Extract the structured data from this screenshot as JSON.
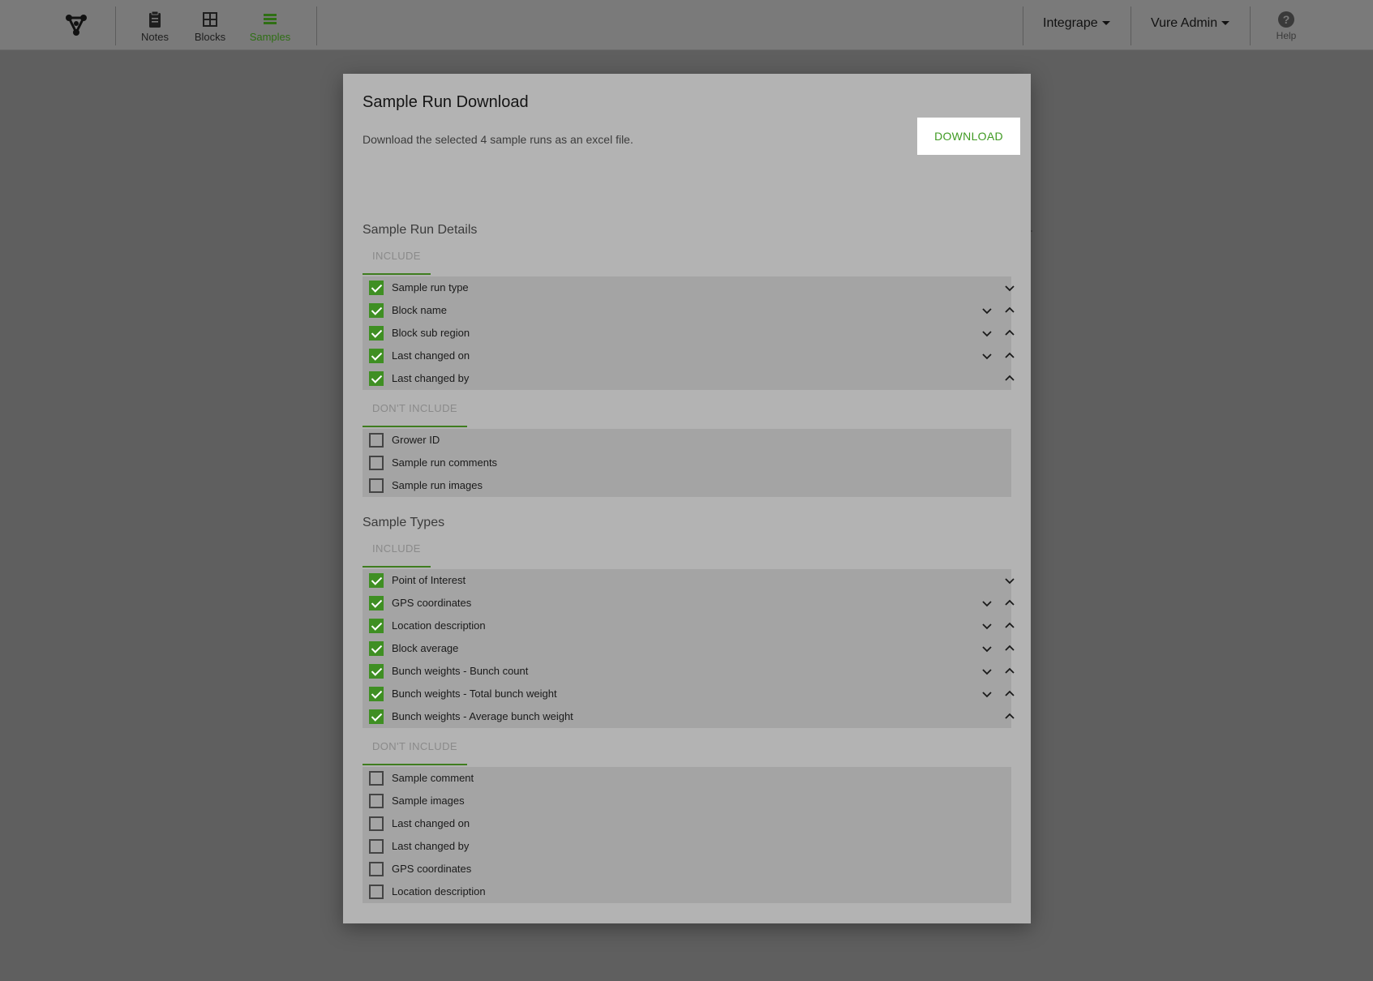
{
  "nav": {
    "items": [
      {
        "label": "Notes",
        "icon": "clipboard-icon"
      },
      {
        "label": "Blocks",
        "icon": "grid-icon"
      },
      {
        "label": "Samples",
        "icon": "list-icon",
        "active": true
      }
    ],
    "org_dropdown": "Integrape",
    "user_dropdown": "Vure Admin",
    "help_label": "Help"
  },
  "colors": {
    "accent": "#3f8f23",
    "nav_bg": "#7a7a7a",
    "modal_bg": "#b3b3b3",
    "list_bg": "#a4a4a4"
  },
  "modal": {
    "title": "Sample Run Download",
    "description": "Download the selected 4 sample runs as an excel file.",
    "download_label": "DOWNLOAD",
    "run_details": {
      "title": "Sample Run Details",
      "include_label": "INCLUDE",
      "include": [
        {
          "label": "Sample run type",
          "checked": true
        },
        {
          "label": "Block name",
          "checked": true
        },
        {
          "label": "Block sub region",
          "checked": true
        },
        {
          "label": "Last changed on",
          "checked": true
        },
        {
          "label": "Last changed by",
          "checked": true
        }
      ],
      "exclude_label": "DON'T INCLUDE",
      "exclude": [
        {
          "label": "Grower ID",
          "checked": false
        },
        {
          "label": "Sample run comments",
          "checked": false
        },
        {
          "label": "Sample run images",
          "checked": false
        }
      ]
    },
    "sample_types": {
      "title": "Sample Types",
      "include_label": "INCLUDE",
      "include": [
        {
          "label": "Point of Interest",
          "checked": true
        },
        {
          "label": "GPS coordinates",
          "checked": true
        },
        {
          "label": "Location description",
          "checked": true
        },
        {
          "label": "Block average",
          "checked": true
        },
        {
          "label": "Bunch weights - Bunch count",
          "checked": true
        },
        {
          "label": "Bunch weights - Total bunch weight",
          "checked": true
        },
        {
          "label": "Bunch weights - Average bunch weight",
          "checked": true
        }
      ],
      "exclude_label": "DON'T INCLUDE",
      "exclude": [
        {
          "label": "Sample comment",
          "checked": false
        },
        {
          "label": "Sample images",
          "checked": false
        },
        {
          "label": "Last changed on",
          "checked": false
        },
        {
          "label": "Last changed by",
          "checked": false
        },
        {
          "label": "GPS coordinates",
          "checked": false
        },
        {
          "label": "Location description",
          "checked": false
        }
      ]
    }
  }
}
